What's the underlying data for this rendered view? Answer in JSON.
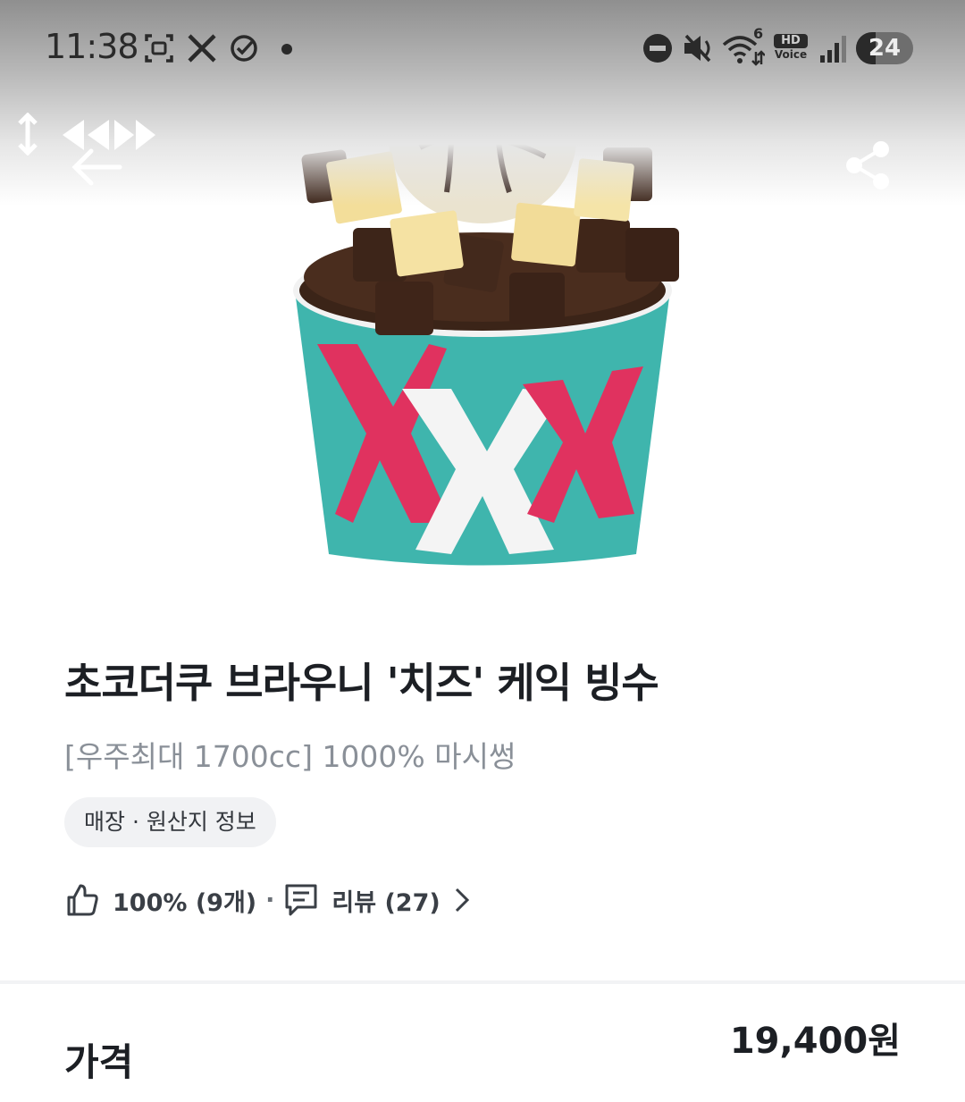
{
  "status_bar": {
    "time": "11:38",
    "network_badge": "6",
    "hd_label": "HD",
    "voice_label": "Voice",
    "battery": "24",
    "icons": [
      "screenshot-icon",
      "x-app-icon",
      "check-circle-icon",
      "dot-icon",
      "dnd-icon",
      "mute-icon",
      "wifi-icon",
      "signal-icon",
      "battery-icon"
    ]
  },
  "nav": {
    "icons": [
      "drag-handle-icon",
      "rewind-icon",
      "fast-forward-icon",
      "back-arrow-icon",
      "share-icon"
    ]
  },
  "product": {
    "title": "초코더쿠 브라우니 '치즈' 케익 빙수",
    "subtitle": "[우주최대 1700cc] 1000% 마시썽",
    "origin_chip": "매장 · 원산지 정보",
    "like_percent": "100% (9개)",
    "dot": "·",
    "review_label": "리뷰 (27)",
    "cup_colors": {
      "teal": "#3fb5ad",
      "pink": "#e0325f",
      "white": "#f4f4f4"
    }
  },
  "price": {
    "label": "가격",
    "value": "19,400원"
  }
}
